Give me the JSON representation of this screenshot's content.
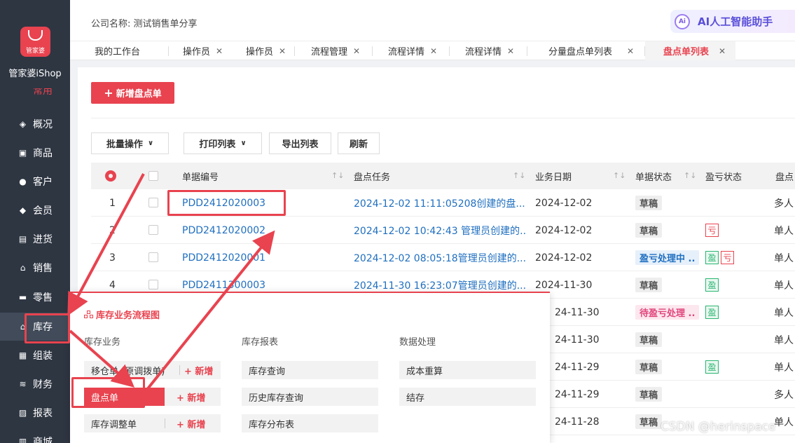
{
  "app": {
    "brand": "管家婆",
    "name": "管家婆iShop"
  },
  "header": {
    "company": "公司名称: 测试销售单分享",
    "ai_assistant": "AI人工智能助手",
    "ai_icon": "Ai"
  },
  "tabs": [
    {
      "label": "我的工作台"
    },
    {
      "label": "操作员"
    },
    {
      "label": "操作员"
    },
    {
      "label": "流程管理"
    },
    {
      "label": "流程详情"
    },
    {
      "label": "流程详情"
    },
    {
      "label": "分量盘点单列表"
    },
    {
      "label": "盘点单列表"
    }
  ],
  "sidebar": {
    "partial_item": "常用",
    "items": [
      {
        "label": "概况"
      },
      {
        "label": "商品"
      },
      {
        "label": "客户"
      },
      {
        "label": "会员"
      },
      {
        "label": "进货"
      },
      {
        "label": "销售"
      },
      {
        "label": "零售"
      },
      {
        "label": "库存"
      },
      {
        "label": "组装"
      },
      {
        "label": "财务"
      },
      {
        "label": "报表"
      },
      {
        "label": "商城"
      }
    ]
  },
  "toolbar": {
    "new_label": "新增盘点单",
    "batch_label": "批量操作",
    "print_label": "打印列表",
    "export_label": "导出列表",
    "refresh_label": "刷新"
  },
  "table": {
    "columns": [
      "单据编号",
      "盘点任务",
      "业务日期",
      "单据状态",
      "盈亏状态",
      "盘点"
    ],
    "rows": [
      {
        "index": "1",
        "number": "PDD2412020003",
        "task": "2024-12-02 11:11:05208创建的盘...",
        "date": "2024-12-02",
        "status": "草稿",
        "last": "多人"
      },
      {
        "index": "2",
        "number": "PDD2412020002",
        "task": "2024-12-02 10:42:43 管理员创建的...",
        "date": "2024-12-02",
        "status": "草稿",
        "last": "单人"
      },
      {
        "index": "3",
        "number": "PDD2412020001",
        "task": "2024-12-02 08:05:18管理员创建的...",
        "date": "2024-12-02",
        "status": "盈亏处理中 ..",
        "last": "单人"
      },
      {
        "index": "4",
        "number": "PDD2411300003",
        "task": "2024-11-30 16:23:07管理员创建的...",
        "date": "2024-11-30",
        "status": "草稿",
        "last": "单人"
      },
      {
        "date": "24-11-30",
        "status": "待盈亏处理 ..",
        "last": "单人"
      },
      {
        "date": "24-11-30",
        "status": "草稿",
        "last": "单人"
      },
      {
        "date": "24-11-29",
        "status": "草稿",
        "last": "单人"
      },
      {
        "date": "24-11-29",
        "status": "草稿",
        "last": "多人"
      },
      {
        "date": "24-11-28",
        "status": "草稿",
        "last": "单人"
      }
    ],
    "gain_tag": "盈",
    "loss_tag": "亏"
  },
  "flow_panel": {
    "title": "库存业务流程图",
    "col1": {
      "heading": "库存业务",
      "items": [
        "移仓单 (原调拨单)",
        "盘点单",
        "库存调整单"
      ],
      "add_label": "+ 新增"
    },
    "col2": {
      "heading": "库存报表",
      "items": [
        "库存查询",
        "历史库存查询",
        "库存分布表"
      ]
    },
    "col3": {
      "heading": "数据处理",
      "items": [
        "成本重算",
        "结存"
      ]
    }
  },
  "watermark": "CSDN @herinspace",
  "colors": {
    "accent": "#e8434f",
    "sidebar": "#2e3642",
    "link": "#1f6fc0"
  }
}
